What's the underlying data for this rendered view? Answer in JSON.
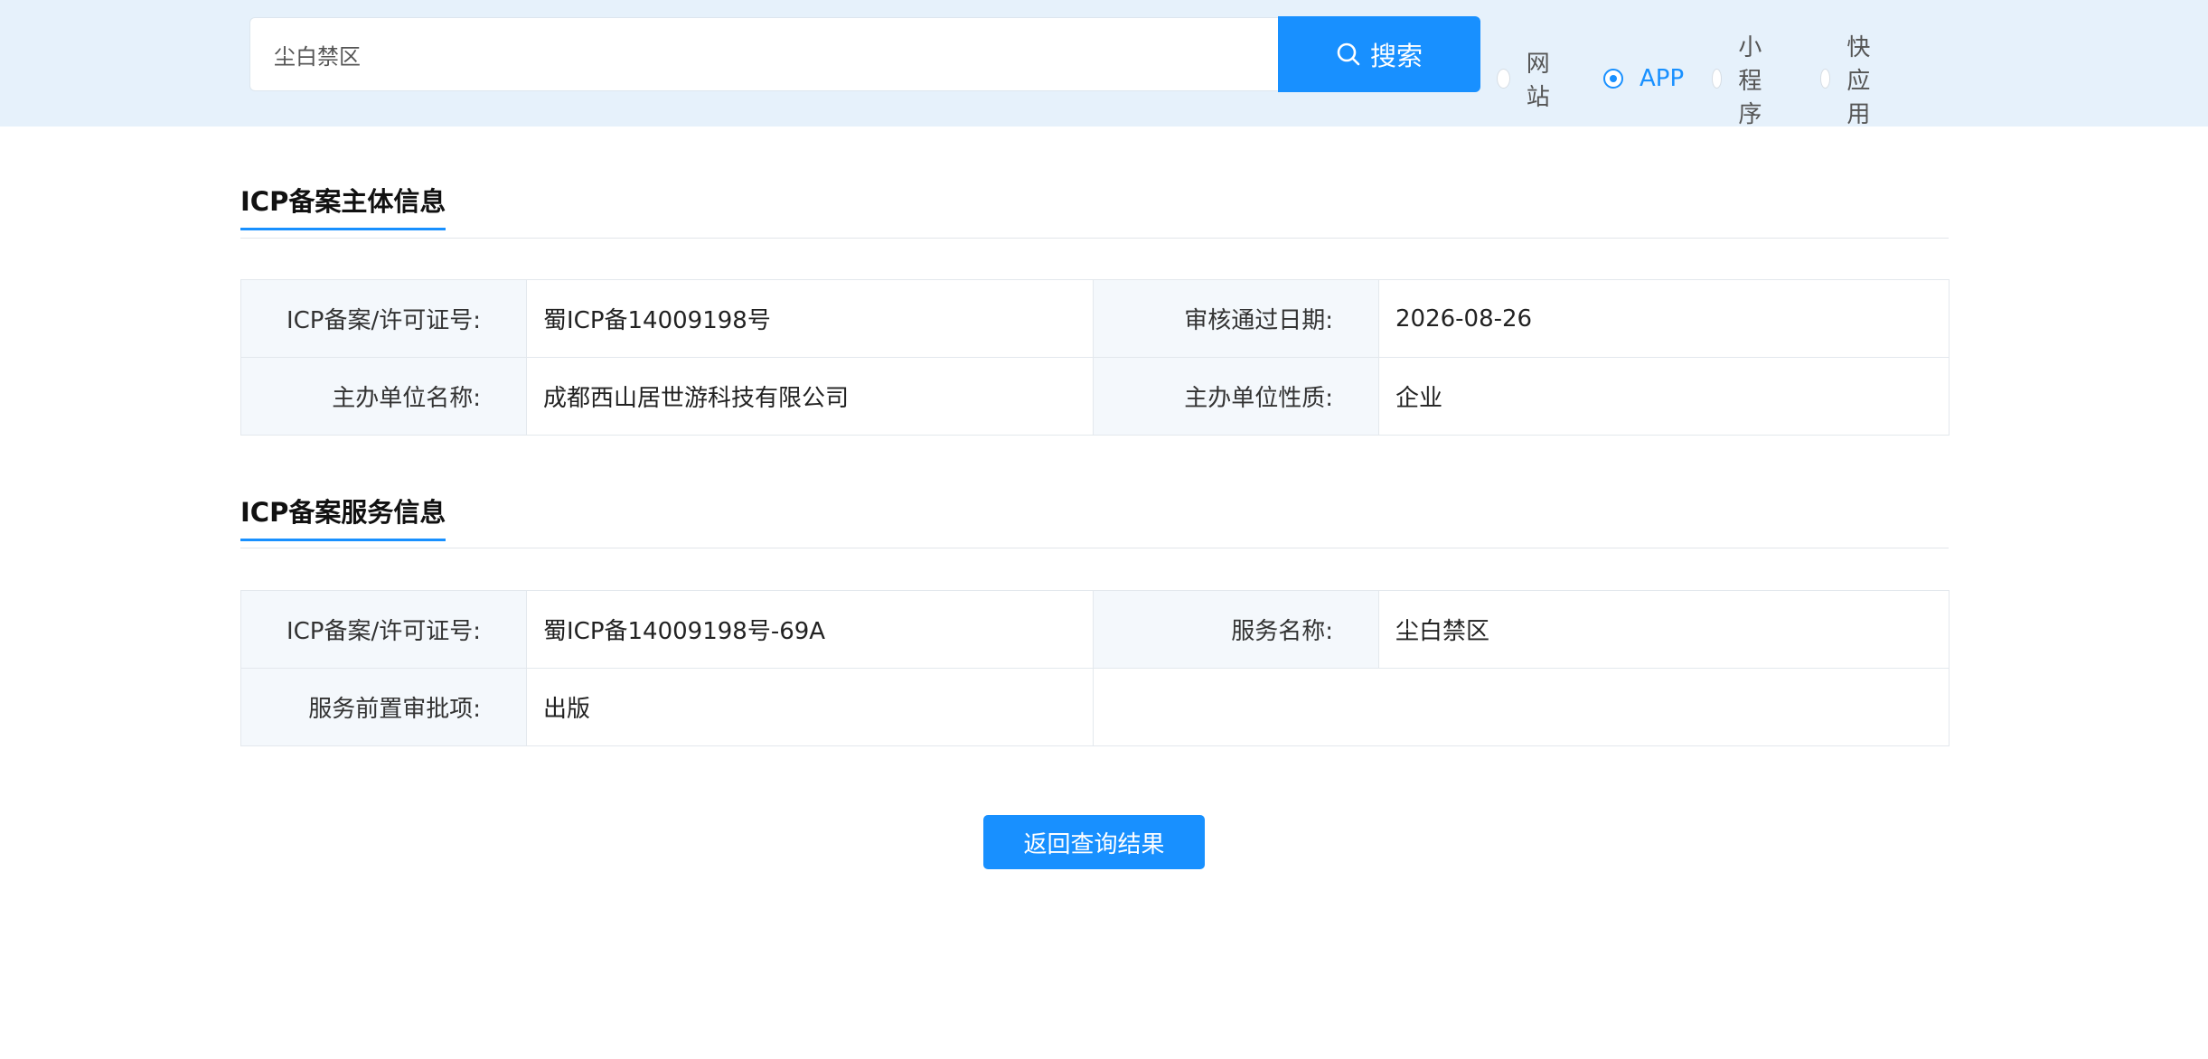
{
  "search": {
    "value": "尘白禁区",
    "placeholder": "",
    "button_label": "搜索"
  },
  "filters": [
    {
      "label": "网站",
      "checked": false
    },
    {
      "label": "APP",
      "checked": true
    },
    {
      "label": "小程序",
      "checked": false
    },
    {
      "label": "快应用",
      "checked": false
    }
  ],
  "subject_section": {
    "title": "ICP备案主体信息",
    "rows": [
      [
        "ICP备案/许可证号:",
        "蜀ICP备14009198号",
        "审核通过日期:",
        "2026-08-26"
      ],
      [
        "主办单位名称:",
        "成都西山居世游科技有限公司",
        "主办单位性质:",
        "企业"
      ]
    ]
  },
  "service_section": {
    "title": "ICP备案服务信息",
    "rows": [
      [
        "ICP备案/许可证号:",
        "蜀ICP备14009198号-69A",
        "服务名称:",
        "尘白禁区"
      ],
      [
        "服务前置审批项:",
        "出版",
        "",
        ""
      ]
    ]
  },
  "back_button_label": "返回查询结果",
  "colors": {
    "accent": "#1890ff",
    "top_bar_bg": "#e6f1fb",
    "label_cell_bg": "#f4f8fc"
  }
}
